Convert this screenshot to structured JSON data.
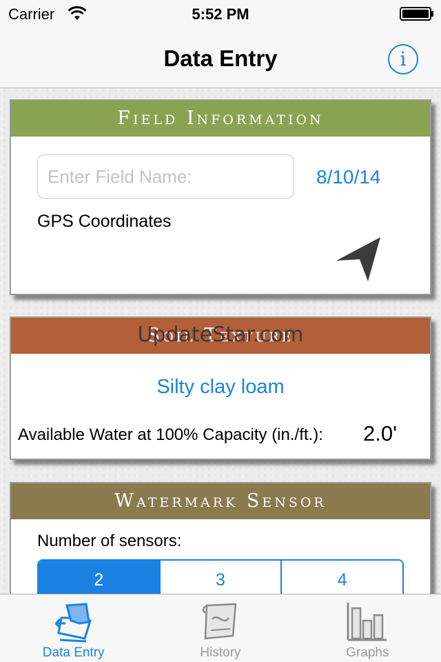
{
  "status": {
    "carrier": "Carrier",
    "time": "5:52 PM"
  },
  "nav": {
    "title": "Data Entry",
    "info_glyph": "i"
  },
  "field_info": {
    "header": "Field Information",
    "field_name_placeholder": "Enter Field Name:",
    "field_name_value": "",
    "date": "8/10/14",
    "gps_label": "GPS Coordinates"
  },
  "soil_texture": {
    "header": "Soil Texture",
    "watermark": "UpdateStar.com",
    "texture": "Silty clay loam",
    "water_label": "Available Water at 100% Capacity (in./ft.):",
    "water_value": "2.0'"
  },
  "watermark_sensor": {
    "header": "Watermark Sensor",
    "count_label": "Number of sensors:",
    "options": [
      "2",
      "3",
      "4"
    ],
    "selected": "2"
  },
  "tabs": [
    {
      "label": "Data Entry",
      "icon": "data-entry-icon",
      "active": true
    },
    {
      "label": "History",
      "icon": "history-scroll-icon",
      "active": false
    },
    {
      "label": "Graphs",
      "icon": "bar-chart-icon",
      "active": false
    }
  ],
  "colors": {
    "accent": "#1a82e2",
    "field_header": "#8aa352",
    "soil_header": "#b35f3a",
    "sensor_header": "#8a7a4e"
  }
}
